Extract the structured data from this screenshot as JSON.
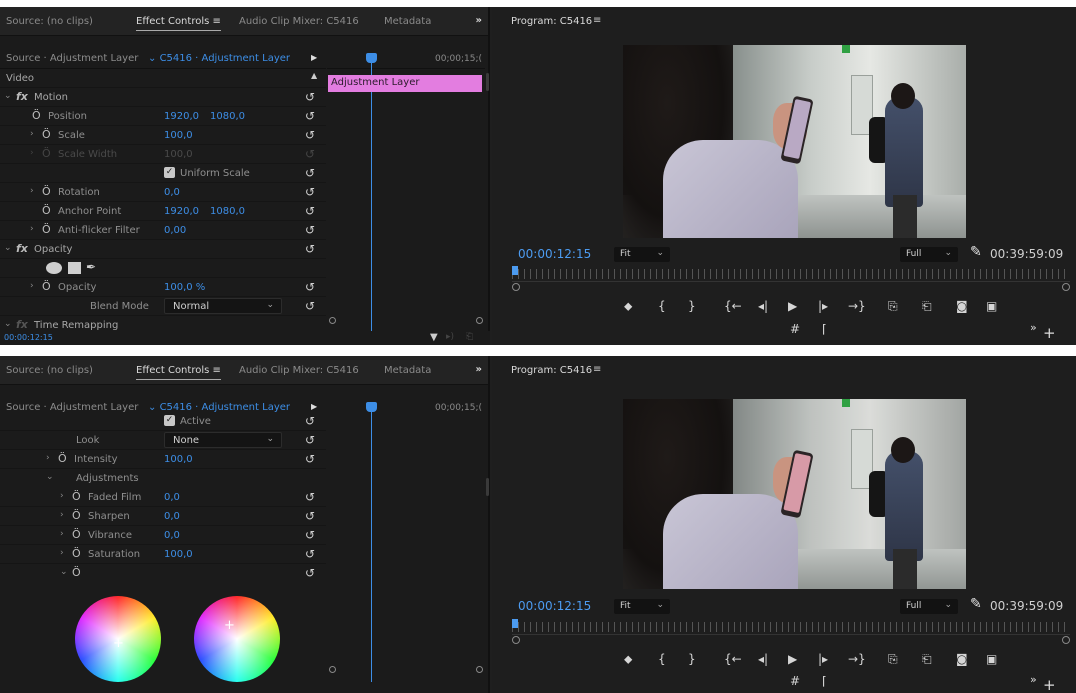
{
  "tabs": {
    "source": "Source: (no clips)",
    "effect_controls": "Effect Controls",
    "effect_menu": "≡",
    "audio_mixer": "Audio Clip Mixer: C5416",
    "metadata": "Metadata",
    "overflow": "»"
  },
  "effect_controls": {
    "source_label": "Source · Adjustment Layer",
    "clip_selector": "C5416 · Adjustment Layer",
    "timecode": "00;00;15;(",
    "clip_name": "Adjustment Layer",
    "current_time": "00:00:12:15"
  },
  "panel1": {
    "video_heading": "Video",
    "motion": "Motion",
    "position": {
      "label": "Position",
      "x": "1920,0",
      "y": "1080,0"
    },
    "scale": {
      "label": "Scale",
      "value": "100,0"
    },
    "scale_width": {
      "label": "Scale Width",
      "value": "100,0"
    },
    "uniform_scale": "Uniform Scale",
    "rotation": {
      "label": "Rotation",
      "value": "0,0"
    },
    "anchor_point": {
      "label": "Anchor Point",
      "x": "1920,0",
      "y": "1080,0"
    },
    "anti_flicker": {
      "label": "Anti-flicker Filter",
      "value": "0,00"
    },
    "opacity_heading": "Opacity",
    "opacity": {
      "label": "Opacity",
      "value": "100,0 %"
    },
    "blend_mode": {
      "label": "Blend Mode",
      "value": "Normal"
    },
    "time_remapping": "Time Remapping"
  },
  "panel2": {
    "active": "Active",
    "look": {
      "label": "Look",
      "value": "None"
    },
    "intensity": {
      "label": "Intensity",
      "value": "100,0"
    },
    "adjustments": "Adjustments",
    "faded_film": {
      "label": "Faded Film",
      "value": "0,0"
    },
    "sharpen": {
      "label": "Sharpen",
      "value": "0,0"
    },
    "vibrance": {
      "label": "Vibrance",
      "value": "0,0"
    },
    "saturation": {
      "label": "Saturation",
      "value": "100,0"
    }
  },
  "program": {
    "title": "Program: C5416",
    "menu": "≡",
    "timecode": "00:00:12:15",
    "fit": "Fit",
    "quality": "Full",
    "duration": "00:39:59:09"
  },
  "icons": {
    "marker": "⬥",
    "in": "{",
    "out": "}",
    "go_in": "{←",
    "step_back": "◂|",
    "play": "▶",
    "step_fwd": "|▸",
    "go_out": "→}",
    "lift": "⎘",
    "extract": "⎗",
    "camera": "◙",
    "compare": "▣",
    "trim": "#",
    "vr": "⌈",
    "more": "»",
    "add": "+",
    "reset": "↺",
    "stopwatch": "Ö",
    "wrench": "🔧"
  },
  "colors": {
    "accent_blue": "#3d8ee6",
    "clip_pink": "#e37de0",
    "panel_bg": "#1b1b1b"
  }
}
